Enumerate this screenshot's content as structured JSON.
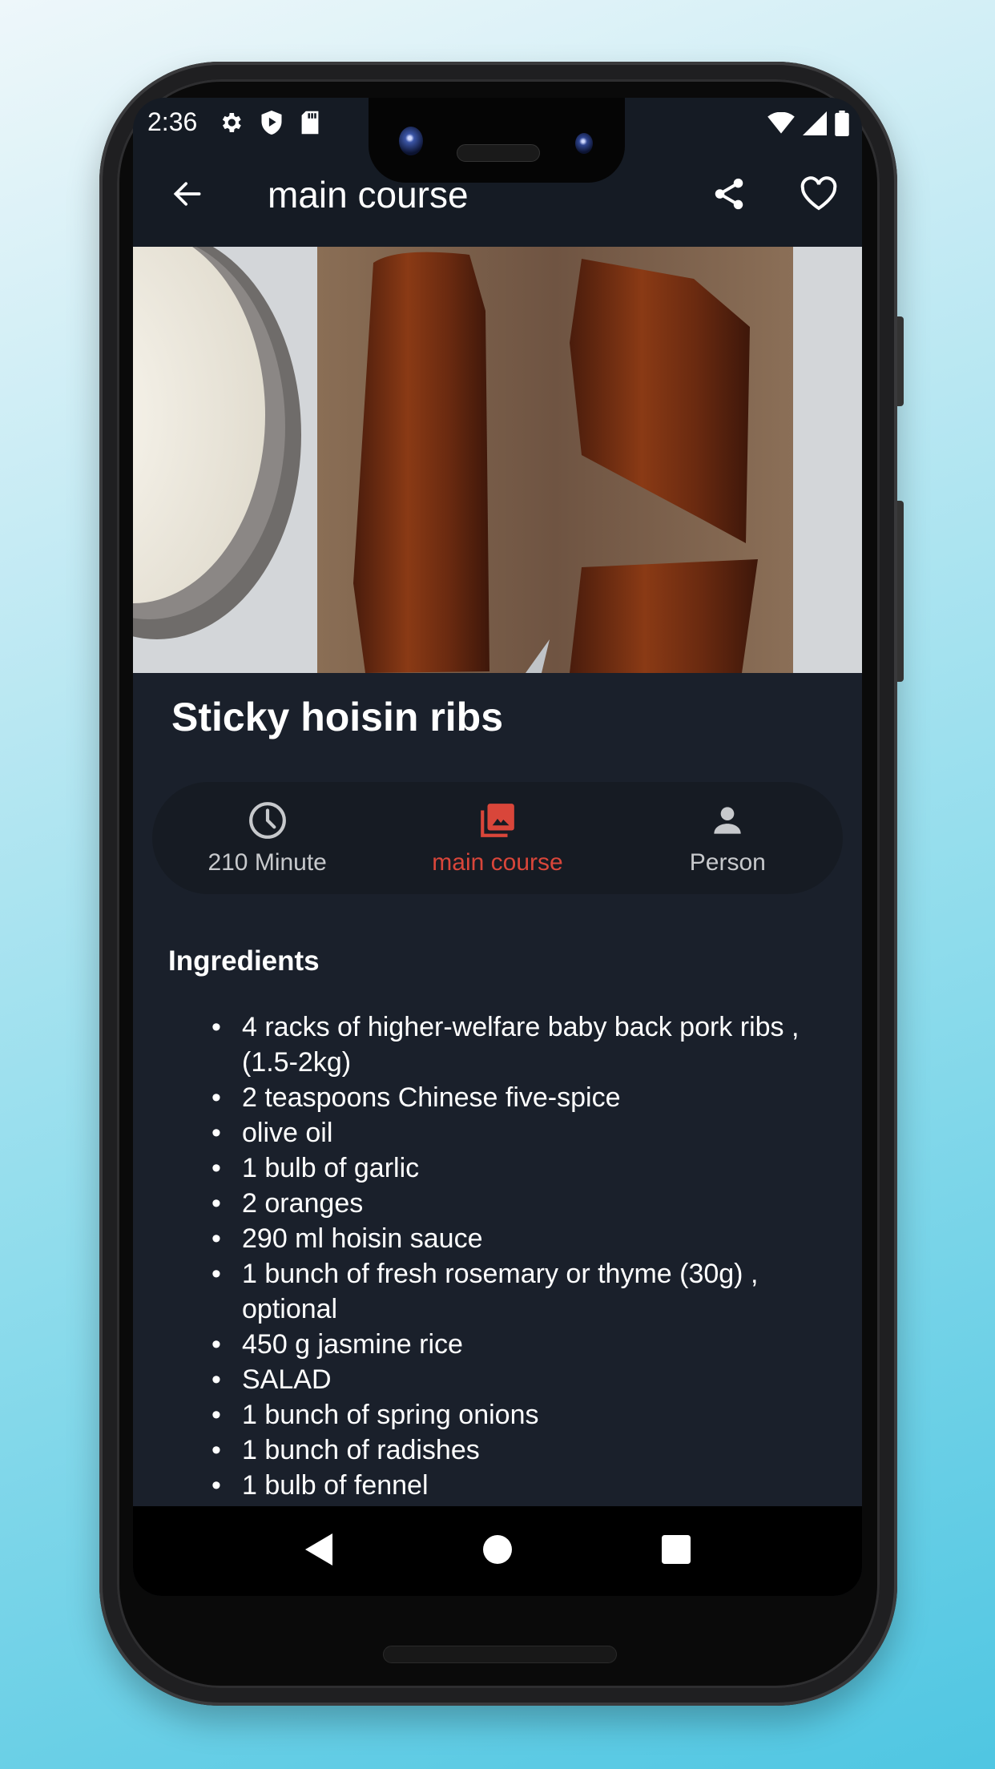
{
  "status_bar": {
    "time": "2:36",
    "left_icons": [
      "gear-icon",
      "shield-play-icon",
      "sd-card-icon"
    ],
    "right_icons": [
      "wifi-icon",
      "signal-icon",
      "battery-icon"
    ]
  },
  "app_bar": {
    "title": "main course",
    "back_icon": "arrow-left-icon",
    "actions": [
      "share-icon",
      "heart-outline-icon"
    ]
  },
  "recipe": {
    "title": "Sticky hoisin ribs",
    "hero_image_alt": "Sticky hoisin ribs on a wooden board with a bowl of jasmine rice"
  },
  "info": {
    "items": [
      {
        "icon": "clock-icon",
        "label": "210 Minute",
        "active": false
      },
      {
        "icon": "photo-library-icon",
        "label": "main course",
        "active": true
      },
      {
        "icon": "person-icon",
        "label": "Person",
        "active": false
      }
    ]
  },
  "ingredients": {
    "title": "Ingredients",
    "items": [
      "4 racks of higher-welfare baby back pork ribs , (1.5-2kg)",
      "2 teaspoons Chinese five-spice",
      "olive oil",
      "1 bulb of garlic",
      "2 oranges",
      "290 ml hoisin sauce",
      "1 bunch of fresh rosemary or thyme (30g) , optional",
      "450 g jasmine rice",
      "SALAD",
      "1 bunch of spring onions",
      "1 bunch of radishes",
      "1 bulb of fennel"
    ]
  },
  "nav_bar": {
    "buttons": [
      "back-triangle-icon",
      "home-circle-icon",
      "recents-square-icon"
    ]
  },
  "colors": {
    "background": "#1a202b",
    "app_bar": "#151b24",
    "pill": "#161b23",
    "accent": "#d9463a",
    "text": "#ffffff",
    "muted_text": "#c7c9cc"
  }
}
